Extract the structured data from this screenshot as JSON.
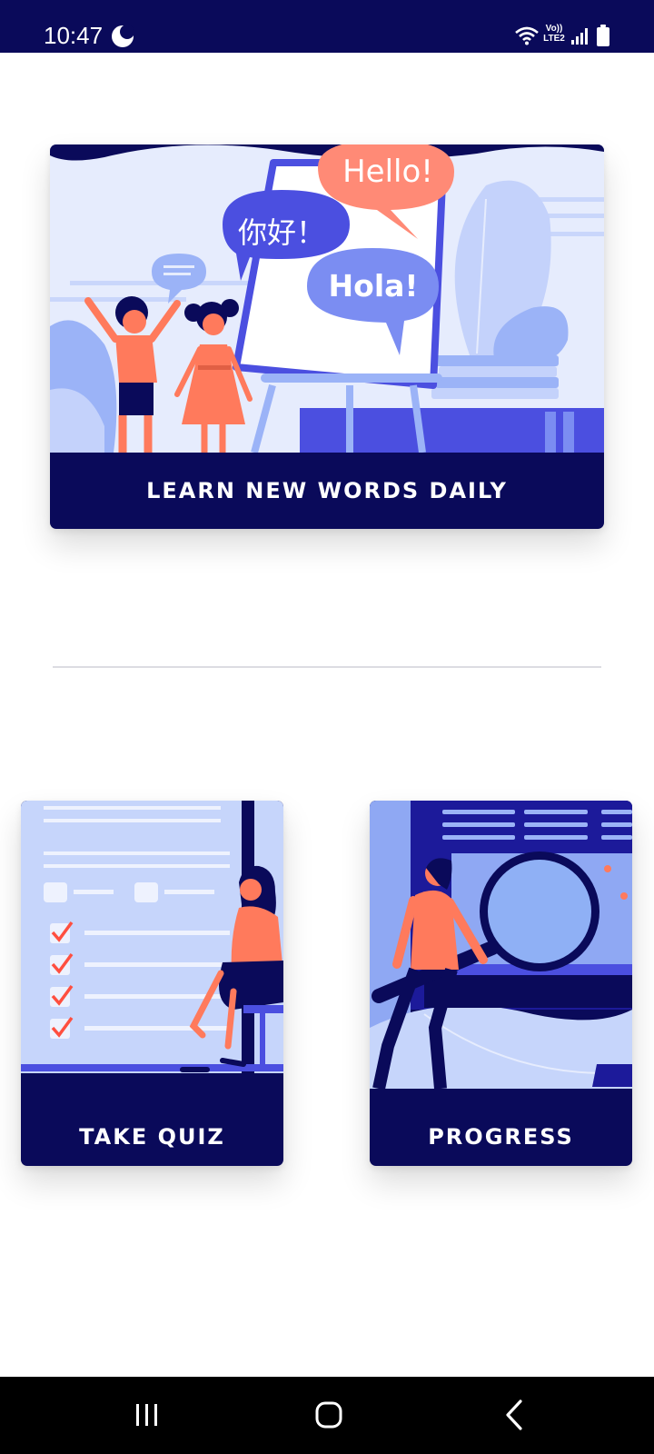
{
  "status_bar": {
    "time": "10:47",
    "network_label_top": "Vo))",
    "network_label_bottom": "LTE2",
    "icons": [
      "moon-icon",
      "wifi-icon",
      "signal-icon",
      "battery-icon"
    ]
  },
  "cards": {
    "learn": {
      "label": "LEARN NEW WORDS DAILY",
      "bubbles": {
        "chinese": "你好！",
        "english": "Hello!",
        "spanish": "Hola!"
      }
    },
    "quiz": {
      "label": "TAKE QUIZ"
    },
    "progress": {
      "label": "PROGRESS"
    }
  },
  "navigation": {
    "icons": [
      "recents-icon",
      "home-icon",
      "back-icon"
    ]
  },
  "colors": {
    "navy": "#0a0a5a",
    "illustration_blue": "#4b4fe0",
    "light_blue": "#c9d6fb",
    "coral": "#ff7a5c"
  }
}
